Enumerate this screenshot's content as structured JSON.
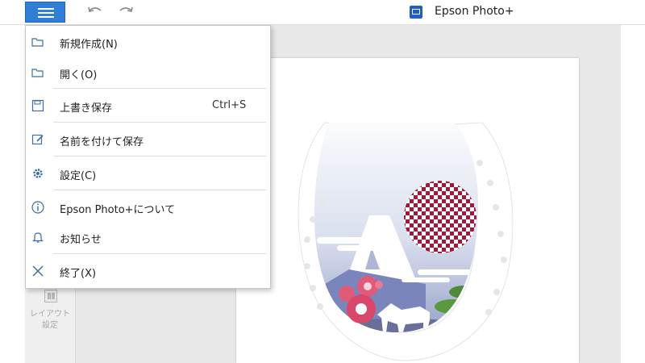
{
  "window": {
    "app_title": "Epson Photo+"
  },
  "toolbar": {
    "menu_icon": "hamburger-icon",
    "undo_icon": "undo-icon",
    "redo_icon": "redo-icon",
    "accent_color": "#2f7fd6"
  },
  "sidebar": {
    "layout_label": "レイアウト 設定"
  },
  "menu": {
    "items": [
      {
        "label": "新規作成(N)",
        "icon": "folder-icon"
      },
      {
        "label": "開く(O)",
        "icon": "folder-open-icon"
      },
      {
        "label": "上書き保存",
        "shortcut": "Ctrl+S",
        "icon": "save-icon"
      },
      {
        "label": "名前を付けて保存",
        "icon": "save-as-icon"
      },
      {
        "label": "設定(C)",
        "icon": "gear-icon"
      },
      {
        "label": "Epson Photo+について",
        "icon": "info-icon"
      },
      {
        "label": "お知らせ",
        "icon": "bell-icon"
      },
      {
        "label": "終了(X)",
        "icon": "close-icon"
      }
    ]
  },
  "canvas": {
    "artwork": "horseshoe-new-year-card-image"
  }
}
